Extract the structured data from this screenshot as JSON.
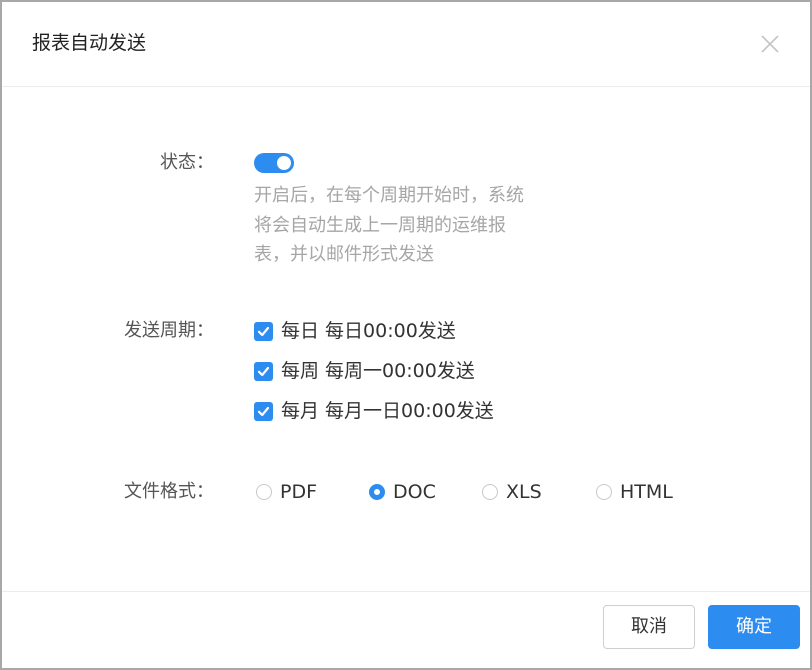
{
  "dialog": {
    "title": "报表自动发送",
    "close_icon": "close-icon"
  },
  "status": {
    "label": "状态：",
    "enabled": true,
    "description_lines": [
      "开启后，在每个周期开始时，系统",
      "将会自动生成上一周期的运维报",
      "表，并以邮件形式发送"
    ]
  },
  "period": {
    "label": "发送周期：",
    "options": [
      {
        "text": "每日 每日00:00发送",
        "checked": true
      },
      {
        "text": "每周 每周一00:00发送",
        "checked": true
      },
      {
        "text": "每月 每月一日00:00发送",
        "checked": true
      }
    ]
  },
  "format": {
    "label": "文件格式：",
    "options": [
      "PDF",
      "DOC",
      "XLS",
      "HTML"
    ],
    "selected": "DOC"
  },
  "footer": {
    "cancel_label": "取消",
    "ok_label": "确定"
  },
  "colors": {
    "accent": "#2d8cf0",
    "muted_text": "#a6a6a6",
    "border": "#cfcfcf"
  }
}
